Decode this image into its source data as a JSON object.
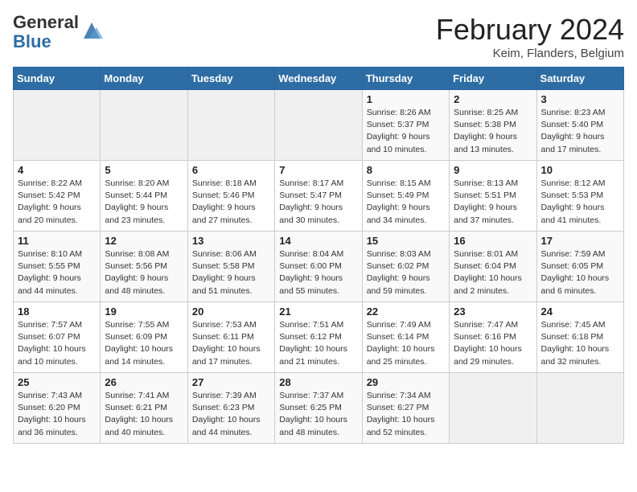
{
  "header": {
    "logo_general": "General",
    "logo_blue": "Blue",
    "month_title": "February 2024",
    "location": "Keim, Flanders, Belgium"
  },
  "weekdays": [
    "Sunday",
    "Monday",
    "Tuesday",
    "Wednesday",
    "Thursday",
    "Friday",
    "Saturday"
  ],
  "weeks": [
    [
      {
        "day": "",
        "info": ""
      },
      {
        "day": "",
        "info": ""
      },
      {
        "day": "",
        "info": ""
      },
      {
        "day": "",
        "info": ""
      },
      {
        "day": "1",
        "info": "Sunrise: 8:26 AM\nSunset: 5:37 PM\nDaylight: 9 hours\nand 10 minutes."
      },
      {
        "day": "2",
        "info": "Sunrise: 8:25 AM\nSunset: 5:38 PM\nDaylight: 9 hours\nand 13 minutes."
      },
      {
        "day": "3",
        "info": "Sunrise: 8:23 AM\nSunset: 5:40 PM\nDaylight: 9 hours\nand 17 minutes."
      }
    ],
    [
      {
        "day": "4",
        "info": "Sunrise: 8:22 AM\nSunset: 5:42 PM\nDaylight: 9 hours\nand 20 minutes."
      },
      {
        "day": "5",
        "info": "Sunrise: 8:20 AM\nSunset: 5:44 PM\nDaylight: 9 hours\nand 23 minutes."
      },
      {
        "day": "6",
        "info": "Sunrise: 8:18 AM\nSunset: 5:46 PM\nDaylight: 9 hours\nand 27 minutes."
      },
      {
        "day": "7",
        "info": "Sunrise: 8:17 AM\nSunset: 5:47 PM\nDaylight: 9 hours\nand 30 minutes."
      },
      {
        "day": "8",
        "info": "Sunrise: 8:15 AM\nSunset: 5:49 PM\nDaylight: 9 hours\nand 34 minutes."
      },
      {
        "day": "9",
        "info": "Sunrise: 8:13 AM\nSunset: 5:51 PM\nDaylight: 9 hours\nand 37 minutes."
      },
      {
        "day": "10",
        "info": "Sunrise: 8:12 AM\nSunset: 5:53 PM\nDaylight: 9 hours\nand 41 minutes."
      }
    ],
    [
      {
        "day": "11",
        "info": "Sunrise: 8:10 AM\nSunset: 5:55 PM\nDaylight: 9 hours\nand 44 minutes."
      },
      {
        "day": "12",
        "info": "Sunrise: 8:08 AM\nSunset: 5:56 PM\nDaylight: 9 hours\nand 48 minutes."
      },
      {
        "day": "13",
        "info": "Sunrise: 8:06 AM\nSunset: 5:58 PM\nDaylight: 9 hours\nand 51 minutes."
      },
      {
        "day": "14",
        "info": "Sunrise: 8:04 AM\nSunset: 6:00 PM\nDaylight: 9 hours\nand 55 minutes."
      },
      {
        "day": "15",
        "info": "Sunrise: 8:03 AM\nSunset: 6:02 PM\nDaylight: 9 hours\nand 59 minutes."
      },
      {
        "day": "16",
        "info": "Sunrise: 8:01 AM\nSunset: 6:04 PM\nDaylight: 10 hours\nand 2 minutes."
      },
      {
        "day": "17",
        "info": "Sunrise: 7:59 AM\nSunset: 6:05 PM\nDaylight: 10 hours\nand 6 minutes."
      }
    ],
    [
      {
        "day": "18",
        "info": "Sunrise: 7:57 AM\nSunset: 6:07 PM\nDaylight: 10 hours\nand 10 minutes."
      },
      {
        "day": "19",
        "info": "Sunrise: 7:55 AM\nSunset: 6:09 PM\nDaylight: 10 hours\nand 14 minutes."
      },
      {
        "day": "20",
        "info": "Sunrise: 7:53 AM\nSunset: 6:11 PM\nDaylight: 10 hours\nand 17 minutes."
      },
      {
        "day": "21",
        "info": "Sunrise: 7:51 AM\nSunset: 6:12 PM\nDaylight: 10 hours\nand 21 minutes."
      },
      {
        "day": "22",
        "info": "Sunrise: 7:49 AM\nSunset: 6:14 PM\nDaylight: 10 hours\nand 25 minutes."
      },
      {
        "day": "23",
        "info": "Sunrise: 7:47 AM\nSunset: 6:16 PM\nDaylight: 10 hours\nand 29 minutes."
      },
      {
        "day": "24",
        "info": "Sunrise: 7:45 AM\nSunset: 6:18 PM\nDaylight: 10 hours\nand 32 minutes."
      }
    ],
    [
      {
        "day": "25",
        "info": "Sunrise: 7:43 AM\nSunset: 6:20 PM\nDaylight: 10 hours\nand 36 minutes."
      },
      {
        "day": "26",
        "info": "Sunrise: 7:41 AM\nSunset: 6:21 PM\nDaylight: 10 hours\nand 40 minutes."
      },
      {
        "day": "27",
        "info": "Sunrise: 7:39 AM\nSunset: 6:23 PM\nDaylight: 10 hours\nand 44 minutes."
      },
      {
        "day": "28",
        "info": "Sunrise: 7:37 AM\nSunset: 6:25 PM\nDaylight: 10 hours\nand 48 minutes."
      },
      {
        "day": "29",
        "info": "Sunrise: 7:34 AM\nSunset: 6:27 PM\nDaylight: 10 hours\nand 52 minutes."
      },
      {
        "day": "",
        "info": ""
      },
      {
        "day": "",
        "info": ""
      }
    ]
  ]
}
